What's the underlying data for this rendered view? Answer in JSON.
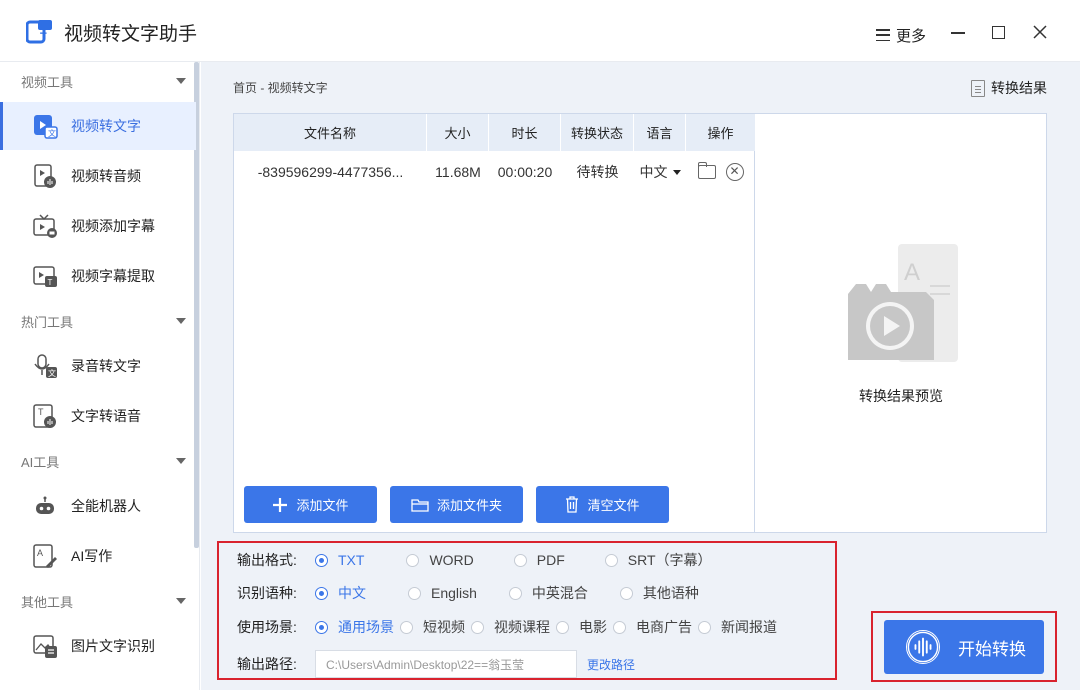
{
  "window": {
    "title": "视频转文字助手",
    "more_label": "更多"
  },
  "sidebar": {
    "sections": [
      {
        "label": "视频工具",
        "items": [
          {
            "label": "视频转文字",
            "icon": "video-text-icon",
            "active": true
          },
          {
            "label": "视频转音频",
            "icon": "video-audio-icon"
          },
          {
            "label": "视频添加字幕",
            "icon": "tv-subtitle-icon"
          },
          {
            "label": "视频字幕提取",
            "icon": "subtitle-extract-icon"
          }
        ]
      },
      {
        "label": "热门工具",
        "items": [
          {
            "label": "录音转文字",
            "icon": "microphone-icon"
          },
          {
            "label": "文字转语音",
            "icon": "text-speech-icon"
          }
        ]
      },
      {
        "label": "AI工具",
        "items": [
          {
            "label": "全能机器人",
            "icon": "robot-icon"
          },
          {
            "label": "AI写作",
            "icon": "ai-writing-icon"
          }
        ]
      },
      {
        "label": "其他工具",
        "items": [
          {
            "label": "图片文字识别",
            "icon": "image-ocr-icon"
          }
        ]
      }
    ]
  },
  "main": {
    "breadcrumb": "首页 - 视频转文字",
    "result_link": "转换结果",
    "table": {
      "columns": [
        "文件名称",
        "大小",
        "时长",
        "转换状态",
        "语言",
        "操作"
      ],
      "rows": [
        {
          "name": "-839596299-4477356...",
          "size": "11.68M",
          "duration": "00:00:20",
          "status": "待转换",
          "language": "中文"
        }
      ]
    },
    "buttons": {
      "add_file": "添加文件",
      "add_folder": "添加文件夹",
      "clear_files": "清空文件"
    },
    "preview_label": "转换结果预览"
  },
  "options": {
    "format": {
      "label": "输出格式:",
      "choices": [
        "TXT",
        "WORD",
        "PDF",
        "SRT（字幕）"
      ],
      "selected": "TXT"
    },
    "language": {
      "label": "识别语种:",
      "choices": [
        "中文",
        "English",
        "中英混合",
        "其他语种"
      ],
      "selected": "中文"
    },
    "scene": {
      "label": "使用场景:",
      "choices": [
        "通用场景",
        "短视频",
        "视频课程",
        "电影",
        "电商广告",
        "新闻报道"
      ],
      "selected": "通用场景"
    },
    "path": {
      "label": "输出路径:",
      "value": "C:\\Users\\Admin\\Desktop\\22==翁玉莹",
      "change_label": "更改路径"
    }
  },
  "start_button": "开始转换",
  "colors": {
    "accent": "#3b76e8",
    "highlight_border": "#d9232e",
    "active_bg": "#e8f0ff"
  }
}
